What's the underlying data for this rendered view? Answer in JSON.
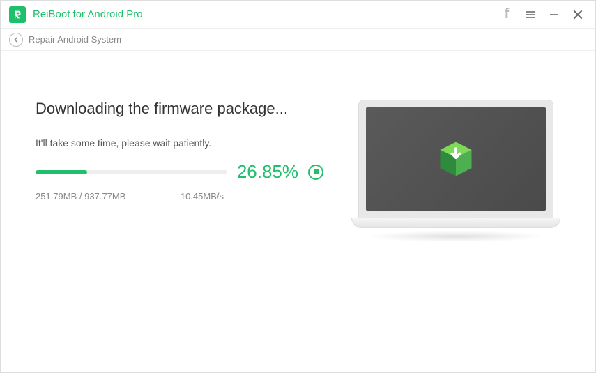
{
  "titlebar": {
    "app_title": "ReiBoot for Android Pro"
  },
  "breadcrumb": {
    "label": "Repair Android System"
  },
  "main": {
    "heading": "Downloading the firmware package...",
    "subtext": "It'll take some time, please wait patiently.",
    "progress_percent": 26.85,
    "percent_text": "26.85%",
    "downloaded_total": "251.79MB / 937.77MB",
    "speed": "10.45MB/s"
  },
  "icons": {
    "logo": "reiboot-logo",
    "facebook": "facebook-icon",
    "menu": "menu-icon",
    "minimize": "minimize-icon",
    "close": "close-icon",
    "back": "back-icon",
    "stop": "stop-icon",
    "package": "package-download-icon"
  },
  "colors": {
    "accent": "#1fbf6c"
  }
}
